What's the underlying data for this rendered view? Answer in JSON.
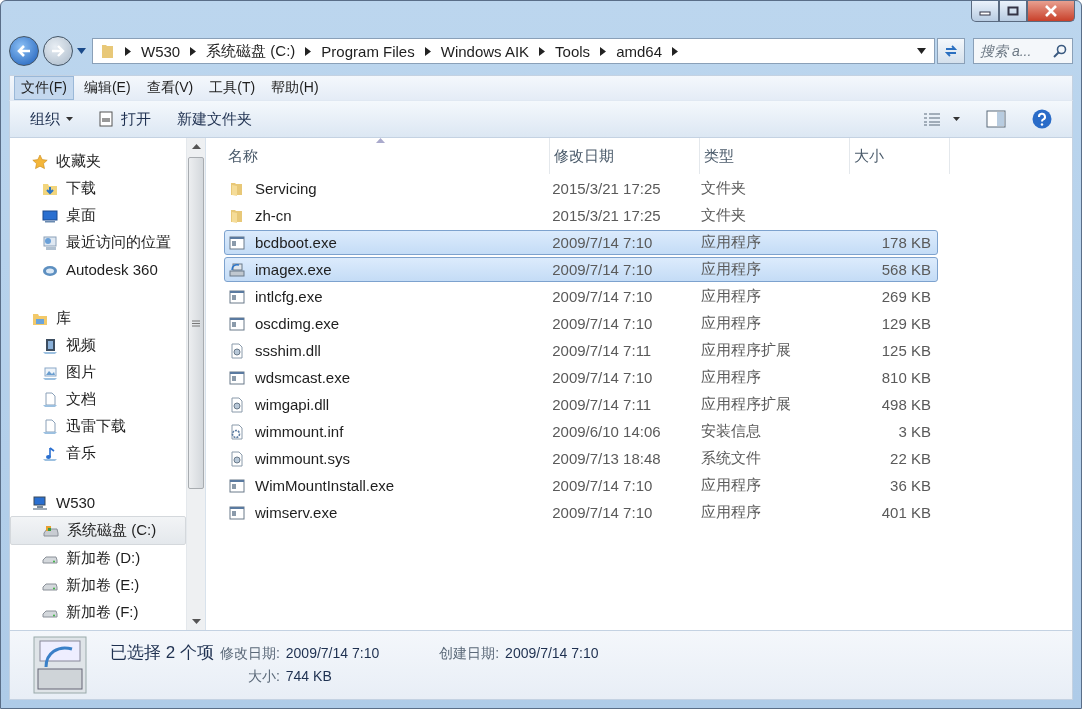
{
  "address": {
    "segments": [
      "W530",
      "系统磁盘 (C:)",
      "Program Files",
      "Windows AIK",
      "Tools",
      "amd64"
    ]
  },
  "search": {
    "placeholder": "搜索 a..."
  },
  "menu": [
    {
      "label": "文件(F)",
      "selected": true
    },
    {
      "label": "编辑(E)",
      "selected": false
    },
    {
      "label": "查看(V)",
      "selected": false
    },
    {
      "label": "工具(T)",
      "selected": false
    },
    {
      "label": "帮助(H)",
      "selected": false
    }
  ],
  "toolbar": {
    "organize": "组织",
    "open": "打开",
    "new_folder": "新建文件夹"
  },
  "sidebar": [
    {
      "label": "收藏夹",
      "kind": "star",
      "selected": false,
      "children": [
        {
          "label": "下载",
          "kind": "download",
          "selected": false
        },
        {
          "label": "桌面",
          "kind": "desktop",
          "selected": false
        },
        {
          "label": "最近访问的位置",
          "kind": "recent",
          "selected": false
        },
        {
          "label": "Autodesk 360",
          "kind": "cloud",
          "selected": false
        }
      ]
    },
    {
      "label": "库",
      "kind": "library",
      "selected": false,
      "children": [
        {
          "label": "视频",
          "kind": "video",
          "selected": false
        },
        {
          "label": "图片",
          "kind": "picture",
          "selected": false
        },
        {
          "label": "文档",
          "kind": "document",
          "selected": false
        },
        {
          "label": "迅雷下载",
          "kind": "document",
          "selected": false
        },
        {
          "label": "音乐",
          "kind": "music",
          "selected": false
        }
      ]
    },
    {
      "label": "W530",
      "kind": "computer",
      "selected": false,
      "children": [
        {
          "label": "系统磁盘 (C:)",
          "kind": "system-drive",
          "selected": true
        },
        {
          "label": "新加卷 (D:)",
          "kind": "drive",
          "selected": false
        },
        {
          "label": "新加卷 (E:)",
          "kind": "drive",
          "selected": false
        },
        {
          "label": "新加卷 (F:)",
          "kind": "drive",
          "selected": false
        }
      ]
    }
  ],
  "table": {
    "columns": [
      "名称",
      "修改日期",
      "类型",
      "大小"
    ],
    "rows": [
      {
        "name": "Servicing",
        "modified": "2015/3/21 17:25",
        "type": "文件夹",
        "kind": "folder",
        "selected": false
      },
      {
        "name": "zh-cn",
        "modified": "2015/3/21 17:25",
        "type": "文件夹",
        "kind": "folder",
        "selected": false
      },
      {
        "name": "bcdboot.exe",
        "modified": "2009/7/14 7:10",
        "type": "应用程序",
        "size": "178 KB",
        "kind": "program",
        "selected": true
      },
      {
        "name": "imagex.exe",
        "modified": "2009/7/14 7:10",
        "type": "应用程序",
        "size": "568 KB",
        "kind": "installer",
        "selected": true
      },
      {
        "name": "intlcfg.exe",
        "modified": "2009/7/14 7:10",
        "type": "应用程序",
        "size": "269 KB",
        "kind": "program",
        "selected": false
      },
      {
        "name": "oscdimg.exe",
        "modified": "2009/7/14 7:10",
        "type": "应用程序",
        "size": "129 KB",
        "kind": "program",
        "selected": false
      },
      {
        "name": "ssshim.dll",
        "modified": "2009/7/14 7:11",
        "type": "应用程序扩展",
        "size": "125 KB",
        "kind": "component",
        "selected": false
      },
      {
        "name": "wdsmcast.exe",
        "modified": "2009/7/14 7:10",
        "type": "应用程序",
        "size": "810 KB",
        "kind": "program",
        "selected": false
      },
      {
        "name": "wimgapi.dll",
        "modified": "2009/7/14 7:11",
        "type": "应用程序扩展",
        "size": "498 KB",
        "kind": "component",
        "selected": false
      },
      {
        "name": "wimmount.inf",
        "modified": "2009/6/10 14:06",
        "type": "安装信息",
        "size": "3 KB",
        "kind": "settings",
        "selected": false
      },
      {
        "name": "wimmount.sys",
        "modified": "2009/7/13 18:48",
        "type": "系统文件",
        "size": "22 KB",
        "kind": "component",
        "selected": false
      },
      {
        "name": "WimMountInstall.exe",
        "modified": "2009/7/14 7:10",
        "type": "应用程序",
        "size": "36 KB",
        "kind": "program",
        "selected": false
      },
      {
        "name": "wimserv.exe",
        "modified": "2009/7/14 7:10",
        "type": "应用程序",
        "size": "401 KB",
        "kind": "program",
        "selected": false
      }
    ]
  },
  "details": {
    "summary": "已选择 2 个项",
    "modified_label": "修改日期:",
    "modified": "2009/7/14 7:10",
    "created_label": "创建日期:",
    "created": "2009/7/14 7:10",
    "size_label": "大小:",
    "size": "744 KB"
  }
}
